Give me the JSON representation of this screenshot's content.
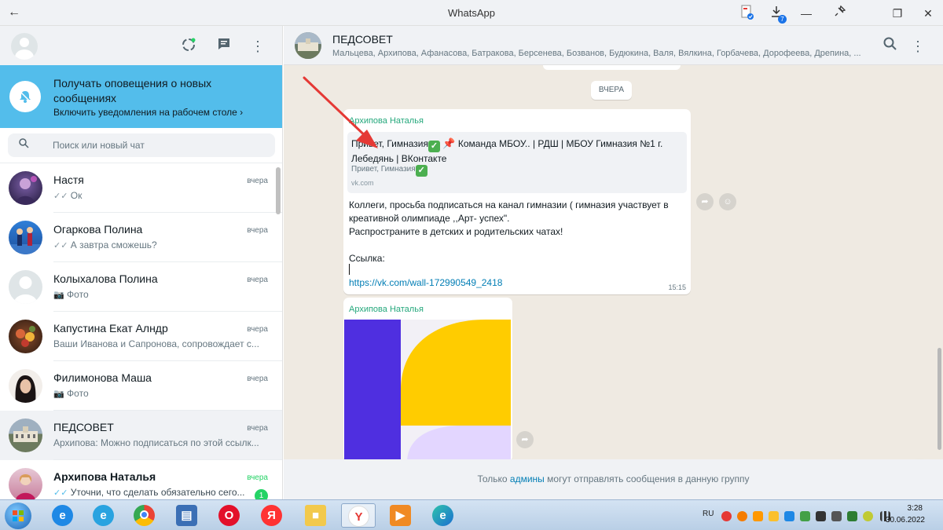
{
  "window": {
    "title": "WhatsApp",
    "back_icon": "arrow-left-icon",
    "controls": {
      "download_count": "7",
      "minimize": "—",
      "restore": "❐",
      "close": "✕"
    }
  },
  "left": {
    "notification": {
      "title": "Получать оповещения о новых сообщениях",
      "link": "Включить уведомления на рабочем столе ›"
    },
    "search": {
      "placeholder": "Поиск или новый чат"
    },
    "chats": [
      {
        "name": "Настя",
        "time": "вчера",
        "preview": "Ок",
        "ticks": "✓✓"
      },
      {
        "name": "Огаркова Полина",
        "time": "вчера",
        "preview": "А завтра сможешь?",
        "ticks": "✓✓"
      },
      {
        "name": "Колыхалова Полина",
        "time": "вчера",
        "preview": "Фото",
        "ticks": ""
      },
      {
        "name": "Капустина Екат Алндр",
        "time": "вчера",
        "preview": "Ваши Иванова и Сапронова, сопровождает с...",
        "ticks": ""
      },
      {
        "name": "Филимонова Маша",
        "time": "вчера",
        "preview": "Фото",
        "ticks": ""
      },
      {
        "name": "ПЕДСОВЕТ",
        "time": "вчера",
        "preview": "Архипова: Можно подписаться по этой ссылк...",
        "ticks": ""
      },
      {
        "name": "Архипова Наталья",
        "time": "вчера",
        "preview": "Уточни, что сделать обязательно сего...",
        "ticks": "✓✓",
        "unread": "1"
      }
    ]
  },
  "right": {
    "group_name": "ПЕДСОВЕТ",
    "members": "Мальцева, Архипова, Афанасова, Батракова, Берсенева, Бозванов, Будюкина, Валя, Вялкина, Горбачева, Дорофеева, Дрепина, ...",
    "date_chip": "ВЧЕРА",
    "message1": {
      "sender": "Архипова Наталья",
      "preview_title_1": "Привет, Гимназия",
      "preview_title_2": "Команда МБОУ.. | РДШ | МБОУ Гимназия №1 г. Лебедянь | ВКонтакте",
      "preview_desc": "Привет, Гимназия",
      "preview_domain": "vk.com",
      "line1": "Коллеги, просьба подписаться на канал гимназии ( гимназия участвует в креативной олимпиаде ,,Арт- успех\".",
      "line2": "Распространите в детских и родительских чатах!",
      "line3": "Ссылка:",
      "link": "https://vk.com/wall-172990549_2418",
      "time": "15:15"
    },
    "message2": {
      "sender": "Архипова Наталья"
    },
    "footer": {
      "before": "Только",
      "admins": "админы",
      "after": "могут отправлять сообщения в данную группу"
    }
  },
  "taskbar": {
    "lang": "RU",
    "time": "3:28",
    "date": "30.06.2022"
  }
}
